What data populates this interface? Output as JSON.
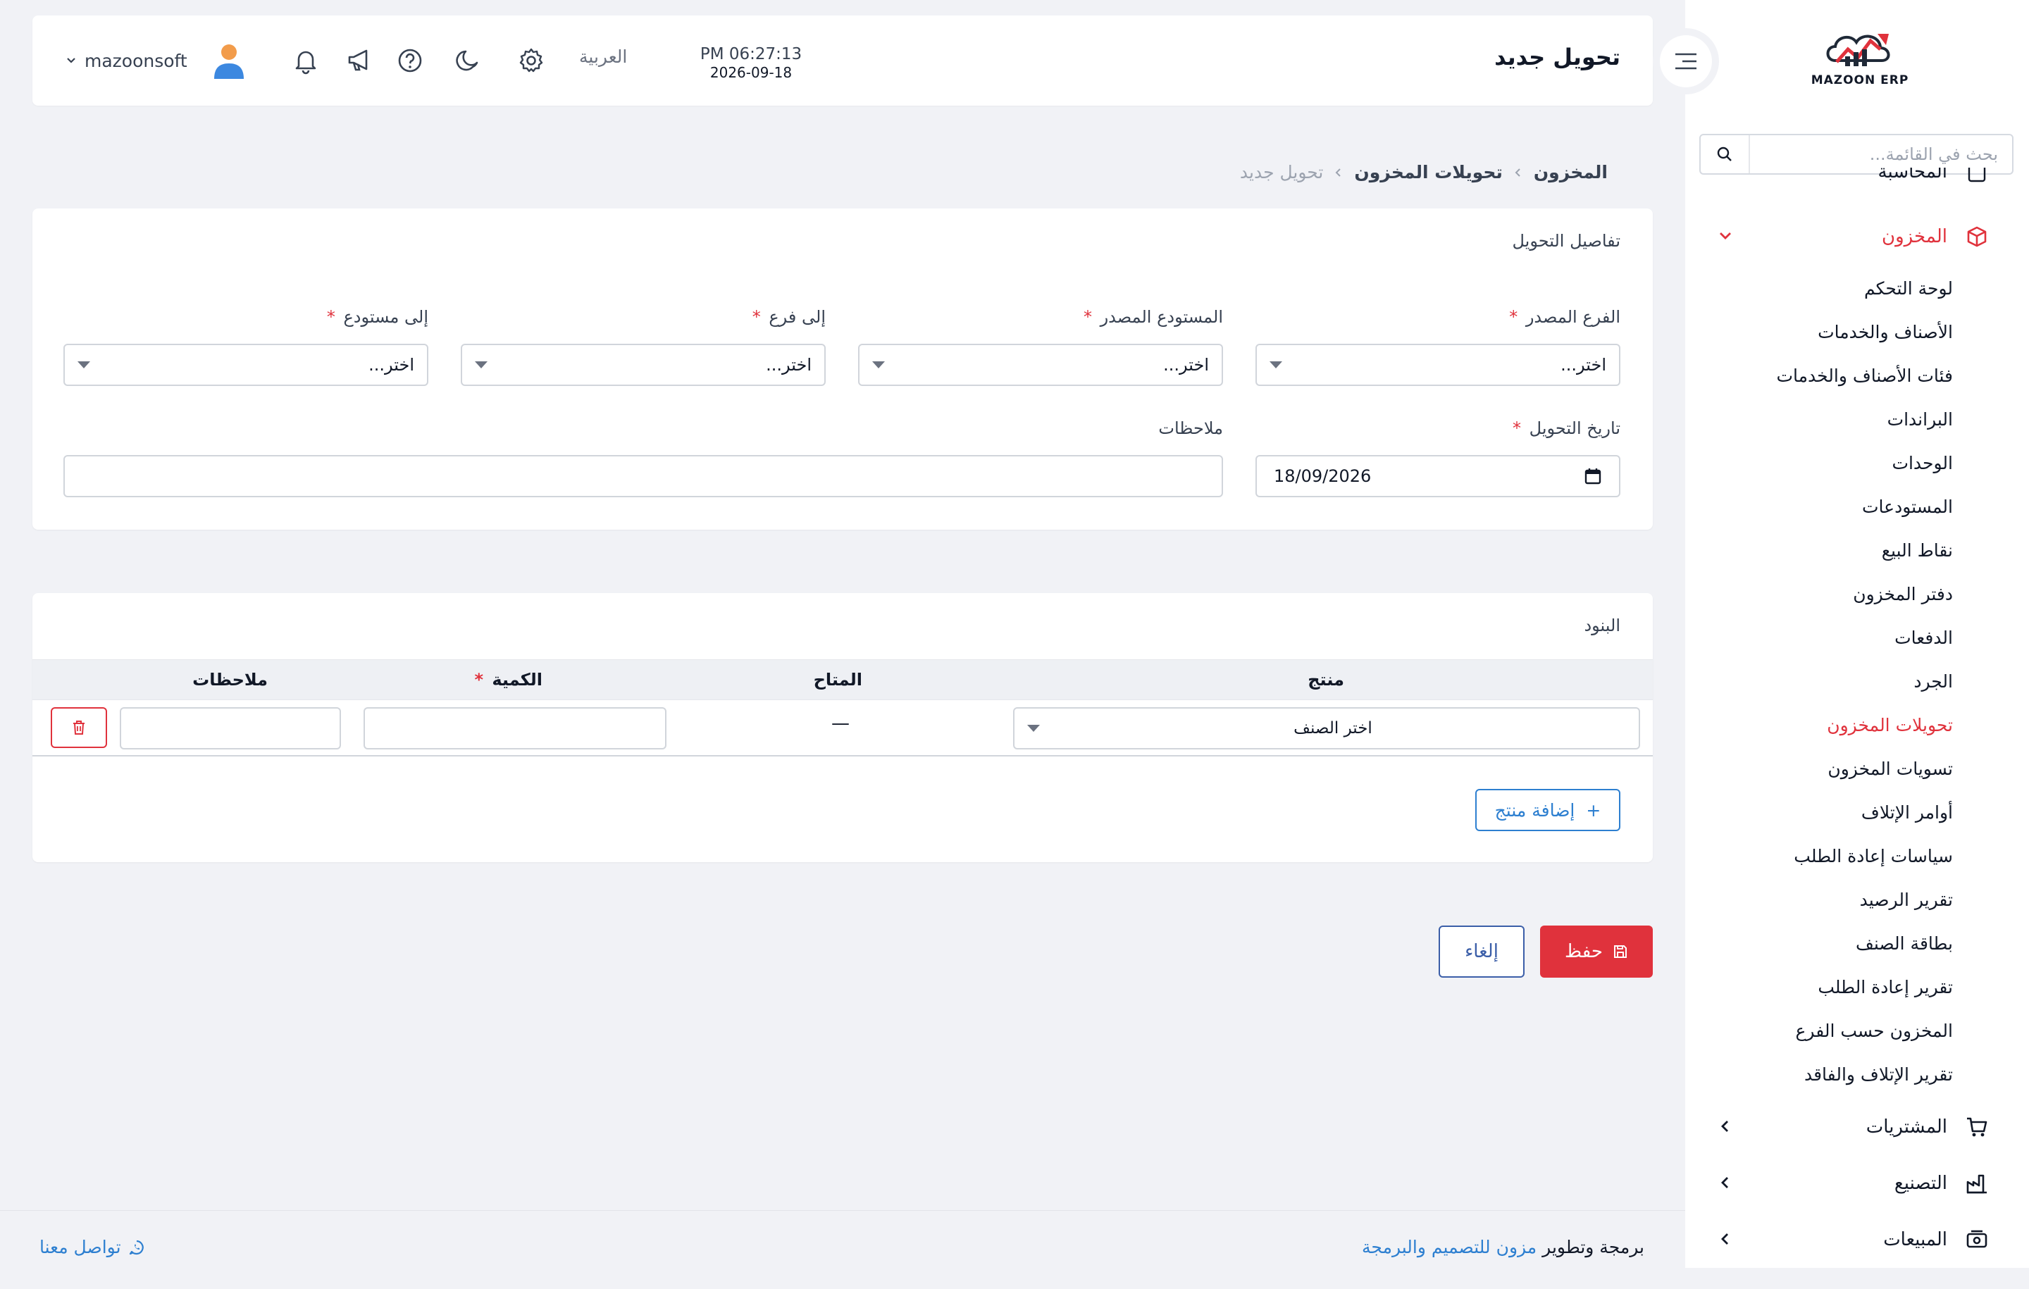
{
  "app": {
    "logo_text": "MAZOON ERP",
    "logo_tag": "ERP"
  },
  "sidebar": {
    "search_placeholder": "بحث في القائمة...",
    "top_partial_label": "المحاسبة",
    "inventory": {
      "label": "المخزون",
      "items": [
        {
          "label": "لوحة التحكم"
        },
        {
          "label": "الأصناف والخدمات"
        },
        {
          "label": "فئات الأصناف والخدمات"
        },
        {
          "label": "البراندات"
        },
        {
          "label": "الوحدات"
        },
        {
          "label": "المستودعات"
        },
        {
          "label": "نقاط البيع"
        },
        {
          "label": "دفتر المخزون"
        },
        {
          "label": "الدفعات"
        },
        {
          "label": "الجرد"
        },
        {
          "label": "تحويلات المخزون",
          "active": true
        },
        {
          "label": "تسويات المخزون"
        },
        {
          "label": "أوامر الإتلاف"
        },
        {
          "label": "سياسات إعادة الطلب"
        },
        {
          "label": "تقرير الرصيد"
        },
        {
          "label": "بطاقة الصنف"
        },
        {
          "label": "تقرير إعادة الطلب"
        },
        {
          "label": "المخزون حسب الفرع"
        },
        {
          "label": "تقرير الإتلاف والفاقد"
        }
      ]
    },
    "purchases": {
      "label": "المشتريات"
    },
    "manufacturing": {
      "label": "التصنيع"
    },
    "sales": {
      "label": "المبيعات"
    }
  },
  "header": {
    "title": "تحويل جديد",
    "time": "PM 06:27:13",
    "date": "2026-09-18",
    "language": "العربية",
    "username": "mazoonsoft"
  },
  "breadcrumb": {
    "items": [
      "المخزون",
      "تحويلات المخزون",
      "تحويل جديد"
    ]
  },
  "details": {
    "title": "تفاصيل التحويل",
    "source_branch": {
      "label": "الفرع المصدر",
      "value": "اختر..."
    },
    "source_warehouse": {
      "label": "المستودع المصدر",
      "value": "اختر..."
    },
    "to_branch": {
      "label": "إلى فرع",
      "value": "اختر..."
    },
    "to_warehouse": {
      "label": "إلى مستودع",
      "value": "اختر..."
    },
    "transfer_date": {
      "label": "تاريخ التحويل",
      "value": "18/09/2026"
    },
    "notes": {
      "label": "ملاحظات",
      "value": ""
    },
    "required_mark": "*"
  },
  "items": {
    "title": "البنود",
    "columns": {
      "product": "منتج",
      "available": "المتاح",
      "quantity": "الكمية",
      "notes": "ملاحظات"
    },
    "rows": [
      {
        "product_placeholder": "اختر الصنف",
        "available": "—",
        "quantity": "",
        "notes": ""
      }
    ],
    "add_button": "إضافة منتج",
    "add_icon": "+"
  },
  "actions": {
    "save": "حفظ",
    "cancel": "إلغاء"
  },
  "footer": {
    "credit_prefix": "برمجة وتطوير",
    "credit_link": "مزون للتصميم والبرمجة",
    "contact": "تواصل معنا"
  },
  "colors": {
    "accent_red": "#e0323c",
    "link_blue": "#2d7fd0",
    "cancel_blue": "#3b5ea8"
  }
}
